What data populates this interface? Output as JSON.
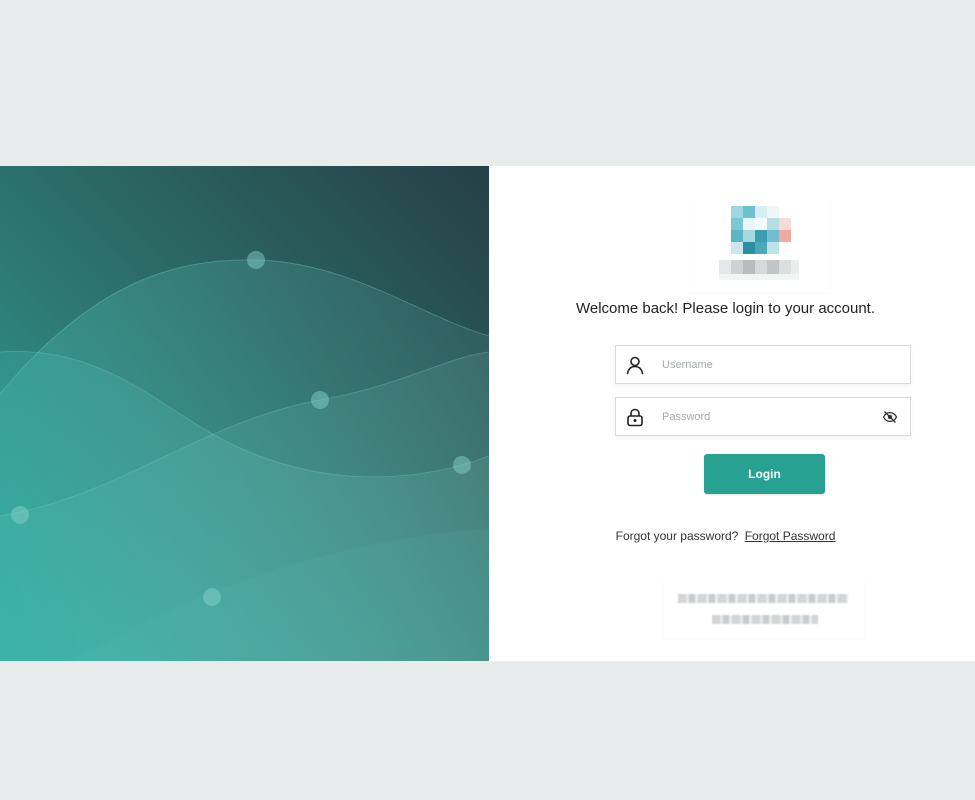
{
  "login": {
    "welcome_text": "Welcome back! Please login to your account.",
    "username_placeholder": "Username",
    "password_placeholder": "Password",
    "login_label": "Login",
    "forgot_prompt": "Forgot your password?",
    "forgot_link": "Forgot Password"
  },
  "icons": {
    "username": "user-icon",
    "password": "lock-icon",
    "toggle_visibility": "eye-slash-icon"
  },
  "colors": {
    "page_background": "#e9ecec",
    "primary_button": "#26a192",
    "hero_dark": "#253f47",
    "hero_light": "#27a89a"
  }
}
